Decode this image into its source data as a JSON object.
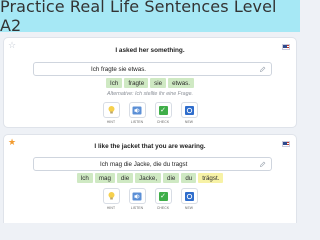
{
  "header": {
    "title": "Practice Real Life Sentences Level A2"
  },
  "cards": [
    {
      "favorite": false,
      "star_icon": "star-outline-icon",
      "flag_icon": "us-flag-icon",
      "prompt": "I asked her something.",
      "answer": "Ich fragte sie etwas.",
      "tokens": [
        {
          "text": "Ich",
          "status": "correct"
        },
        {
          "text": "fragte",
          "status": "correct"
        },
        {
          "text": "sie",
          "status": "correct"
        },
        {
          "text": "etwas.",
          "status": "correct"
        }
      ],
      "alternative": "Alternative: Ich stellte ihr eine Frage."
    },
    {
      "favorite": true,
      "star_icon": "star-filled-icon",
      "flag_icon": "us-flag-icon",
      "prompt": "I like the jacket that you are wearing.",
      "answer": "Ich mag die Jacke, die du tragst",
      "tokens": [
        {
          "text": "Ich",
          "status": "correct"
        },
        {
          "text": "mag",
          "status": "correct"
        },
        {
          "text": "die",
          "status": "correct"
        },
        {
          "text": "Jacke,",
          "status": "correct"
        },
        {
          "text": "die",
          "status": "correct"
        },
        {
          "text": "du",
          "status": "correct"
        },
        {
          "text": "trägst.",
          "status": "corrected"
        }
      ]
    }
  ],
  "actions": {
    "hint": "HINT",
    "listen": "LISTEN",
    "check": "CHECK",
    "new": "NEW"
  },
  "colors": {
    "header_bg": "#a6e8f5",
    "correct_token": "#cfe9c3",
    "corrected_token": "#f7f2a6",
    "check_green": "#3fae49",
    "new_blue": "#2f6dcc",
    "star_orange": "#f29a2e"
  }
}
